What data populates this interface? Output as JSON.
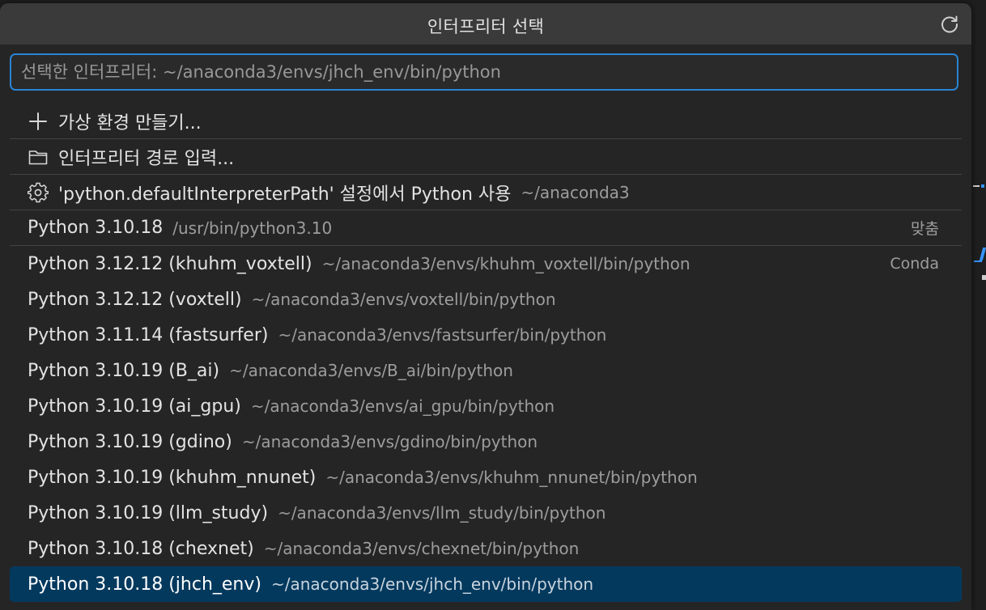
{
  "title": "인터프리터 선택",
  "search": {
    "placeholder": "선택한 인터프리터: ~/anaconda3/envs/jhch_env/bin/python",
    "value": ""
  },
  "actions": [
    {
      "icon": "plus-icon",
      "label": "가상 환경 만들기..."
    },
    {
      "icon": "folder-icon",
      "label": "인터프리터 경로 입력..."
    },
    {
      "icon": "gear-icon",
      "label": "'python.defaultInterpreterPath' 설정에서 Python 사용",
      "desc": "~/anaconda3"
    }
  ],
  "interpreters": [
    {
      "label": "Python 3.10.18",
      "desc": "/usr/bin/python3.10",
      "tag": "맞춤"
    },
    {
      "label": "Python 3.12.12 (khuhm_voxtell)",
      "desc": "~/anaconda3/envs/khuhm_voxtell/bin/python",
      "tag": "Conda"
    },
    {
      "label": "Python 3.12.12 (voxtell)",
      "desc": "~/anaconda3/envs/voxtell/bin/python"
    },
    {
      "label": "Python 3.11.14 (fastsurfer)",
      "desc": "~/anaconda3/envs/fastsurfer/bin/python"
    },
    {
      "label": "Python 3.10.19 (B_ai)",
      "desc": "~/anaconda3/envs/B_ai/bin/python"
    },
    {
      "label": "Python 3.10.19 (ai_gpu)",
      "desc": "~/anaconda3/envs/ai_gpu/bin/python"
    },
    {
      "label": "Python 3.10.19 (gdino)",
      "desc": "~/anaconda3/envs/gdino/bin/python"
    },
    {
      "label": "Python 3.10.19 (khuhm_nnunet)",
      "desc": "~/anaconda3/envs/khuhm_nnunet/bin/python"
    },
    {
      "label": "Python 3.10.19 (llm_study)",
      "desc": "~/anaconda3/envs/llm_study/bin/python"
    },
    {
      "label": "Python 3.10.18 (chexnet)",
      "desc": "~/anaconda3/envs/chexnet/bin/python"
    },
    {
      "label": "Python 3.10.18 (jhch_env)",
      "desc": "~/anaconda3/envs/jhch_env/bin/python",
      "selected": true
    }
  ],
  "colors": {
    "accent": "#2a84d2",
    "selected_bg": "#04395e",
    "panel_bg": "#252526",
    "title_bg": "#3a3a3a"
  }
}
